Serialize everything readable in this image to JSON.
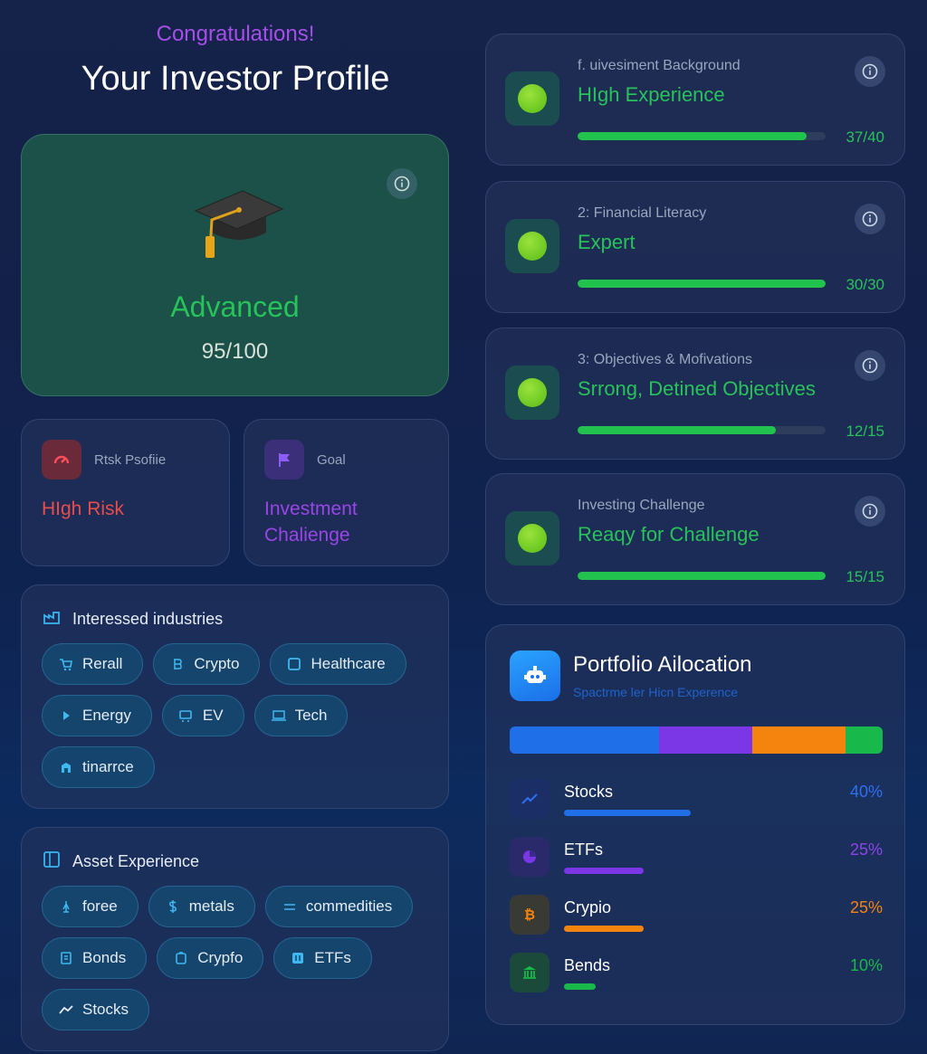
{
  "header": {
    "congrats": "Congratulations!",
    "title": "Your Investor Profile"
  },
  "hero": {
    "level": "Advanced",
    "score": "95/100",
    "icon": "graduation-cap-icon"
  },
  "risk": {
    "label": "Rtsk Psofiie",
    "value": "HIgh Risk",
    "color": "#e54848"
  },
  "goal": {
    "label": "Goal",
    "value": "Investment Chalienge",
    "color": "#9a45e6"
  },
  "industries": {
    "title": "Interessed industries",
    "chips": [
      "Rerall",
      "Crypto",
      "Healthcare",
      "Energy",
      "EV",
      "Tech",
      "tinarrce"
    ]
  },
  "assets": {
    "title": "Asset Experience",
    "chips": [
      "foree",
      "metals",
      "commedities",
      "Bonds",
      "Crypfo",
      "ETFs",
      "Stocks"
    ]
  },
  "scores": [
    {
      "subtitle": "f. uivesiment Background",
      "title": "HIgh Experience",
      "score": "37/40",
      "fraction": 0.925
    },
    {
      "subtitle": "2: Financial Literacy",
      "title": "Expert",
      "score": "30/30",
      "fraction": 1.0
    },
    {
      "subtitle": "3: Objectives & Mofivations",
      "title": "Srrong, Detined Objectives",
      "score": "12/15",
      "fraction": 0.8
    },
    {
      "subtitle": "Investing Challenge",
      "title": "Reaqy for Challenge",
      "score": "15/15",
      "fraction": 1.0
    }
  ],
  "portfolio": {
    "title": "Portfolio Ailocation",
    "subtitle": "Spactrme ler Hicn Experence",
    "segments": [
      {
        "fraction": 0.4,
        "color": "#1f6fe8"
      },
      {
        "fraction": 0.25,
        "color": "#7b36e6"
      },
      {
        "fraction": 0.25,
        "color": "#f5840f"
      },
      {
        "fraction": 0.1,
        "color": "#18b84a"
      }
    ],
    "items": [
      {
        "name": "Stocks",
        "pct": "40%",
        "fraction": 0.4,
        "color": "#1f6fe8",
        "icon": "trend-line-icon"
      },
      {
        "name": "ETFs",
        "pct": "25%",
        "fraction": 0.25,
        "color": "#7b36e6",
        "icon": "pie-chart-icon"
      },
      {
        "name": "Crypio",
        "pct": "25%",
        "fraction": 0.25,
        "color": "#f5840f",
        "icon": "bitcoin-icon"
      },
      {
        "name": "Bends",
        "pct": "10%",
        "fraction": 0.1,
        "color": "#18b84a",
        "icon": "bank-icon"
      }
    ]
  }
}
